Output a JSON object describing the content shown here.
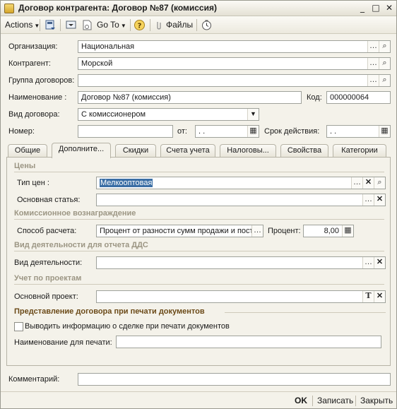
{
  "window": {
    "title": "Договор контрагента: Договор №87 (комиссия)"
  },
  "toolbar": {
    "actions_label": "Actions",
    "goto_label": "Go To",
    "files_label": "Файлы"
  },
  "header_fields": {
    "organization_label": "Организация:",
    "organization_value": "Национальная",
    "counterparty_label": "Контрагент:",
    "counterparty_value": "Морской",
    "group_label": "Группа договоров:",
    "group_value": "",
    "name_label": "Наименование :",
    "name_value": "Договор №87 (комиссия)",
    "code_label": "Код:",
    "code_value": "000000064",
    "contract_type_label": "Вид договора:",
    "contract_type_value": "С комиссионером",
    "number_label": "Номер:",
    "number_value": "",
    "from_label": "от:",
    "from_value": " .  .",
    "validity_label": "Срок действия:",
    "validity_value": " .  ."
  },
  "tabs": [
    {
      "label": "Общие"
    },
    {
      "label": "Дополните..."
    },
    {
      "label": "Скидки"
    },
    {
      "label": "Счета учета"
    },
    {
      "label": "Налоговы..."
    },
    {
      "label": "Свойства"
    },
    {
      "label": "Категории"
    }
  ],
  "active_tab": "Дополните...",
  "panel": {
    "prices_section": "Цены",
    "price_type_label": "Тип цен :",
    "price_type_value": "Мелкооптовая",
    "main_article_label": "Основная статья:",
    "main_article_value": "",
    "commission_section": "Комиссионное вознаграждение",
    "calc_method_label": "Способ расчета:",
    "calc_method_value": "Процент от разности сумм продажи и пост",
    "percent_label": "Процент:",
    "percent_value": "8,00",
    "dds_section": "Вид деятельности для отчета ДДС",
    "activity_label": "Вид деятельности:",
    "activity_value": "",
    "projects_section": "Учет по проектам",
    "main_project_label": "Основной проект:",
    "main_project_value": "",
    "print_section": "Представление договора при печати документов",
    "print_checkbox_label": "Выводить информацию о сделке при печати документов",
    "print_checkbox_checked": false,
    "print_name_label": "Наименование для печати:",
    "print_name_value": ""
  },
  "comment": {
    "label": "Комментарий:",
    "value": ""
  },
  "bottom": {
    "ok_label": "OK",
    "save_label": "Записать",
    "close_label": "Закрыть"
  },
  "colors": {
    "background": "#f4f2ea",
    "section_title": "#9c9684",
    "print_section_title": "#6b4a18",
    "selection": "#3a6ea5"
  }
}
